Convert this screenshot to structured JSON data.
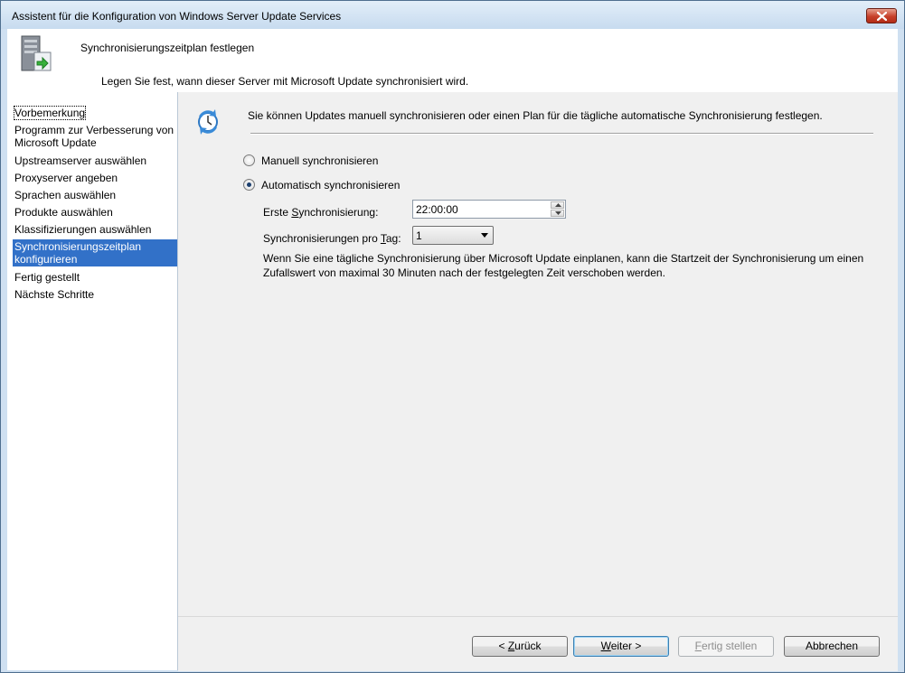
{
  "window": {
    "title": "Assistent für die Konfiguration von Windows Server Update Services"
  },
  "header": {
    "title": "Synchronisierungszeitplan festlegen",
    "description": "Legen Sie fest, wann dieser Server mit Microsoft Update synchronisiert wird."
  },
  "sidebar": {
    "items": [
      {
        "label": "Vorbemerkung"
      },
      {
        "label": "Programm zur Verbesserung von Microsoft Update"
      },
      {
        "label": "Upstreamserver auswählen"
      },
      {
        "label": "Proxyserver angeben"
      },
      {
        "label": "Sprachen auswählen"
      },
      {
        "label": "Produkte auswählen"
      },
      {
        "label": "Klassifizierungen auswählen"
      },
      {
        "label": "Synchronisierungszeitplan konfigurieren"
      },
      {
        "label": "Fertig gestellt"
      },
      {
        "label": "Nächste Schritte"
      }
    ],
    "selected_index": 7,
    "focused_index": 0
  },
  "main": {
    "intro": "Sie können Updates manuell synchronisieren oder einen Plan für die tägliche automatische Synchronisierung festlegen.",
    "manual_option": {
      "label": "Manuell synchronisieren",
      "checked": false
    },
    "auto_option": {
      "label": "Automatisch synchronisieren",
      "checked": true
    },
    "first_sync": {
      "label_pre": "Erste ",
      "label_key": "S",
      "label_post": "ynchronisierung:",
      "value": "22:00:00"
    },
    "per_day": {
      "label_pre": "Synchronisierungen pro ",
      "label_key": "T",
      "label_post": "ag:",
      "value": "1"
    },
    "note": "Wenn Sie eine tägliche Synchronisierung über Microsoft Update einplanen, kann die Startzeit der Synchronisierung um einen Zufallswert von maximal 30 Minuten nach der festgelegten Zeit verschoben werden."
  },
  "footer": {
    "back": {
      "pre": "< ",
      "key": "Z",
      "post": "urück"
    },
    "next": {
      "pre": "",
      "key": "W",
      "post": "eiter >"
    },
    "finish": {
      "pre": "",
      "key": "F",
      "post": "ertig stellen"
    },
    "cancel": {
      "label": "Abbrechen"
    }
  },
  "icons": {
    "header_icon": "server-sync-icon",
    "intro_icon": "sync-clock-icon",
    "close_icon": "close-icon"
  },
  "colors": {
    "selection": "#3271c8",
    "close_button": "#c7402a",
    "window_frame": "#cfe0f1"
  }
}
